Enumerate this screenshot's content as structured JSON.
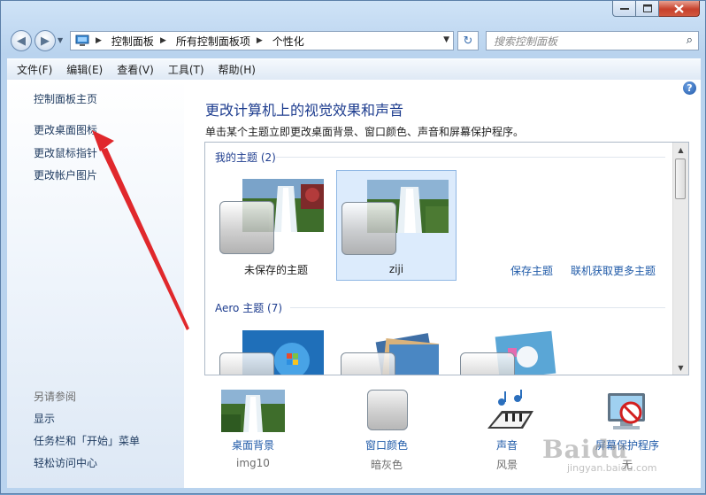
{
  "window": {
    "controls": {
      "minimize": "–",
      "maximize": "□",
      "close": "✕"
    }
  },
  "nav": {
    "back_icon": "back-arrow-icon",
    "forward_icon": "forward-arrow-icon",
    "breadcrumb": [
      "控制面板",
      "所有控制面板项",
      "个性化"
    ],
    "search_placeholder": "搜索控制面板"
  },
  "menu": [
    "文件(F)",
    "编辑(E)",
    "查看(V)",
    "工具(T)",
    "帮助(H)"
  ],
  "sidebar": {
    "links": [
      "控制面板主页",
      "更改桌面图标",
      "更改鼠标指针",
      "更改帐户图片"
    ],
    "see_also_title": "另请参阅",
    "see_also": [
      "显示",
      "任务栏和「开始」菜单",
      "轻松访问中心"
    ]
  },
  "main": {
    "title": "更改计算机上的视觉效果和声音",
    "description": "单击某个主题立即更改桌面背景、窗口颜色、声音和屏幕保护程序。",
    "my_themes_header": "我的主题 (2)",
    "my_themes": [
      {
        "name": "未保存的主题",
        "selected": false
      },
      {
        "name": "ziji",
        "selected": true
      }
    ],
    "save_theme_link": "保存主题",
    "more_themes_link": "联机获取更多主题",
    "aero_header": "Aero 主题 (7)"
  },
  "bottom": [
    {
      "label": "桌面背景",
      "value": "img10"
    },
    {
      "label": "窗口颜色",
      "value": "暗灰色"
    },
    {
      "label": "声音",
      "value": "风景"
    },
    {
      "label": "屏幕保护程序",
      "value": "无"
    }
  ],
  "watermark": {
    "brand": "Baidu",
    "sub": "jingyan.baidu.com"
  },
  "colors": {
    "link": "#1f5aa8",
    "heading": "#1e3d8f",
    "selection": "#dcebfc",
    "annotation_arrow": "#e0282c"
  }
}
